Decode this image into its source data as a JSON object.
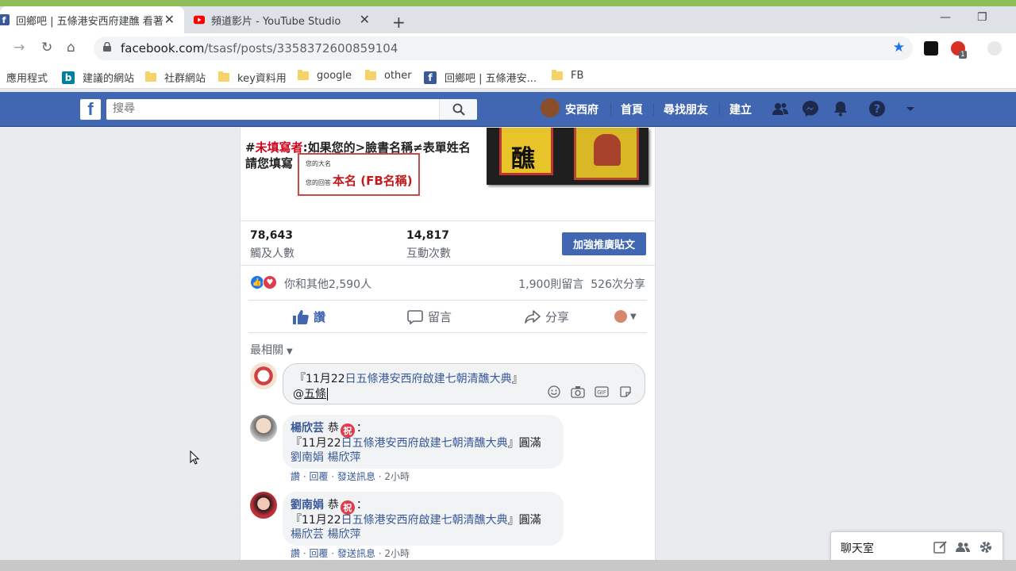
{
  "browser": {
    "tabs": [
      {
        "title": "回鄉吧 | 五條港安西府建醮 看著",
        "active": true
      },
      {
        "title": "頻道影片 - YouTube Studio",
        "active": false
      }
    ],
    "url_host": "facebook.com",
    "url_path": "/tsasf/posts/3358372600859104",
    "ext_badge": "1",
    "bookmarks": [
      {
        "label": "應用程式",
        "icon": "apps-icon"
      },
      {
        "label": "建議的網站",
        "icon": "bing-icon"
      },
      {
        "label": "社群網站",
        "icon": "folder-icon"
      },
      {
        "label": "key資料用",
        "icon": "folder-icon"
      },
      {
        "label": "google",
        "icon": "folder-icon"
      },
      {
        "label": "other",
        "icon": "folder-icon"
      },
      {
        "label": "回鄉吧 | 五條港安...",
        "icon": "facebook-icon"
      },
      {
        "label": "FB",
        "icon": "folder-icon"
      }
    ]
  },
  "fb": {
    "search_placeholder": "搜尋",
    "profile_name": "安西府",
    "nav": [
      "首頁",
      "尋找朋友",
      "建立"
    ]
  },
  "post": {
    "image_text_2_prefix": "#",
    "image_text_2_red": "未填寫者",
    "image_text_2_rest": ":如果您的>臉書名稱≠表單姓名",
    "image_text_3": "請您填寫",
    "namebox_small1": "您的大名",
    "namebox_small2": "您的回答",
    "namebox_big": "本名 (FB名稱)",
    "amulet_char": "醮",
    "reach_value": "78,643",
    "reach_label": "觸及人數",
    "engage_value": "14,817",
    "engage_label": "互動次數",
    "boost_label": "加強推廣貼文",
    "reactions_text": "你和其他2,590人",
    "comments_count": "1,900則留言",
    "shares_count": "526次分享",
    "like_label": "讚",
    "comment_label": "留言",
    "share_label": "分享",
    "sort_label": "最相關",
    "composer_line1_a": "『11月22",
    "composer_line1_b": "日五條港安西府啟建七朝清醮大典",
    "composer_line1_c": "』",
    "composer_line2_at": "@",
    "composer_line2_mention": "五條"
  },
  "comments": [
    {
      "author": "楊欣芸",
      "prefix": "恭",
      "suffix": "：",
      "body_a": "『11月22",
      "body_b": "日五條港安西府啟建七朝清醮大典",
      "body_c": "』圓滿",
      "tags": "劉南娟 楊欣萍",
      "like": "讚",
      "reply": "回覆",
      "message": "發送訊息",
      "time": "2小時"
    },
    {
      "author": "劉南娟",
      "prefix": "恭",
      "suffix": "：",
      "body_a": "『11月22",
      "body_b": "日五條港安西府啟建七朝清醮大典",
      "body_c": "』圓滿",
      "tags": "楊欣芸 楊欣萍",
      "like": "讚",
      "reply": "回覆",
      "message": "發送訊息",
      "time": "2小時"
    }
  ],
  "chat": {
    "label": "聊天室"
  },
  "colors": {
    "fb_blue": "#4267b2",
    "link_blue": "#385898",
    "love_red": "#e03b4a"
  }
}
